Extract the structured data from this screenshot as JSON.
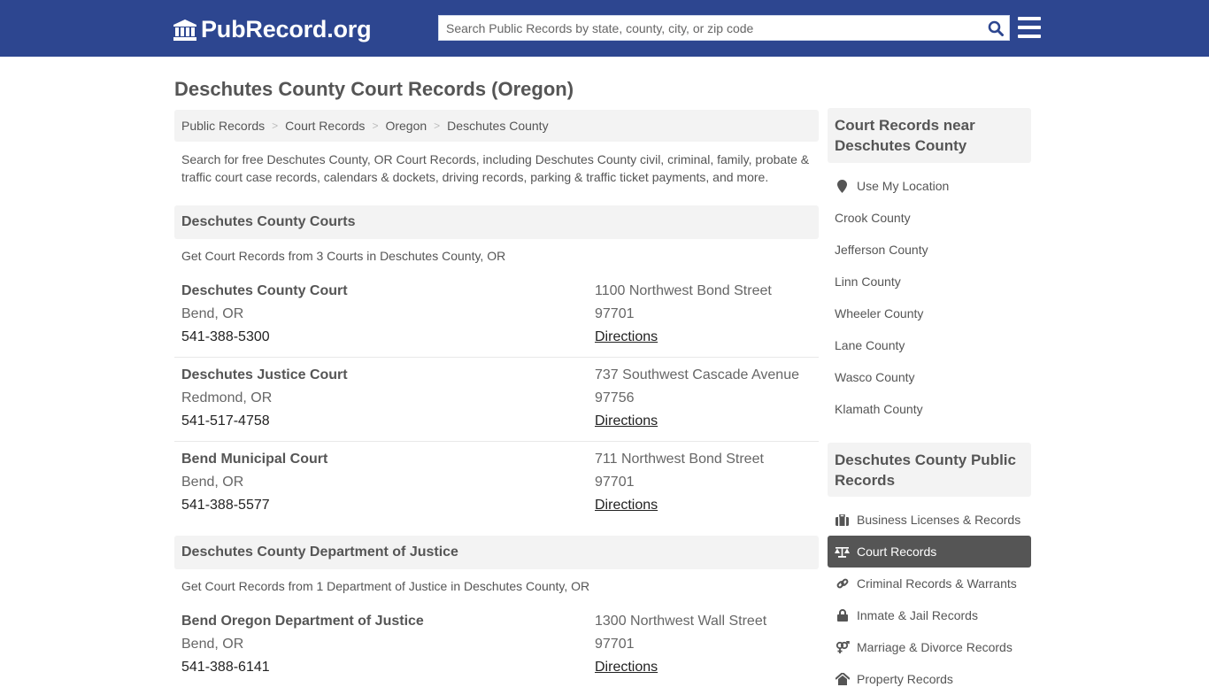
{
  "header": {
    "logo_text": "PubRecord.org",
    "search_placeholder": "Search Public Records by state, county, city, or zip code",
    "brand_color": "#2d4690"
  },
  "page_title": "Deschutes County Court Records (Oregon)",
  "breadcrumb": [
    "Public Records",
    "Court Records",
    "Oregon",
    "Deschutes County"
  ],
  "intro": "Search for free Deschutes County, OR Court Records, including Deschutes County civil, criminal, family, probate & traffic court case records, calendars & dockets, driving records, parking & traffic ticket payments, and more.",
  "sections": [
    {
      "title": "Deschutes County Courts",
      "subtitle": "Get Court Records from 3 Courts in Deschutes County, OR",
      "records": [
        {
          "name": "Deschutes County Court",
          "city": "Bend, OR",
          "phone": "541-388-5300",
          "address": "1100 Northwest Bond Street",
          "zip": "97701",
          "link": "Directions"
        },
        {
          "name": "Deschutes Justice Court",
          "city": "Redmond, OR",
          "phone": "541-517-4758",
          "address": "737 Southwest Cascade Avenue",
          "zip": "97756",
          "link": "Directions"
        },
        {
          "name": "Bend Municipal Court",
          "city": "Bend, OR",
          "phone": "541-388-5577",
          "address": "711 Northwest Bond Street",
          "zip": "97701",
          "link": "Directions"
        }
      ]
    },
    {
      "title": "Deschutes County Department of Justice",
      "subtitle": "Get Court Records from 1 Department of Justice in Deschutes County, OR",
      "records": [
        {
          "name": "Bend Oregon Department of Justice",
          "city": "Bend, OR",
          "phone": "541-388-6141",
          "address": "1300 Northwest Wall Street",
          "zip": "97701",
          "link": "Directions"
        }
      ]
    }
  ],
  "sidebar": {
    "nearby_title": "Court Records near Deschutes County",
    "use_location": "Use My Location",
    "nearby": [
      "Crook County",
      "Jefferson County",
      "Linn County",
      "Wheeler County",
      "Lane County",
      "Wasco County",
      "Klamath County"
    ],
    "public_title": "Deschutes County Public Records",
    "public_items": [
      {
        "label": "Business Licenses & Records",
        "icon": "briefcase-icon"
      },
      {
        "label": "Court Records",
        "icon": "scale-icon",
        "active": true
      },
      {
        "label": "Criminal Records & Warrants",
        "icon": "link-icon"
      },
      {
        "label": "Inmate & Jail Records",
        "icon": "lock-icon"
      },
      {
        "label": "Marriage & Divorce Records",
        "icon": "venus-mars-icon"
      },
      {
        "label": "Property Records",
        "icon": "home-icon"
      }
    ]
  }
}
